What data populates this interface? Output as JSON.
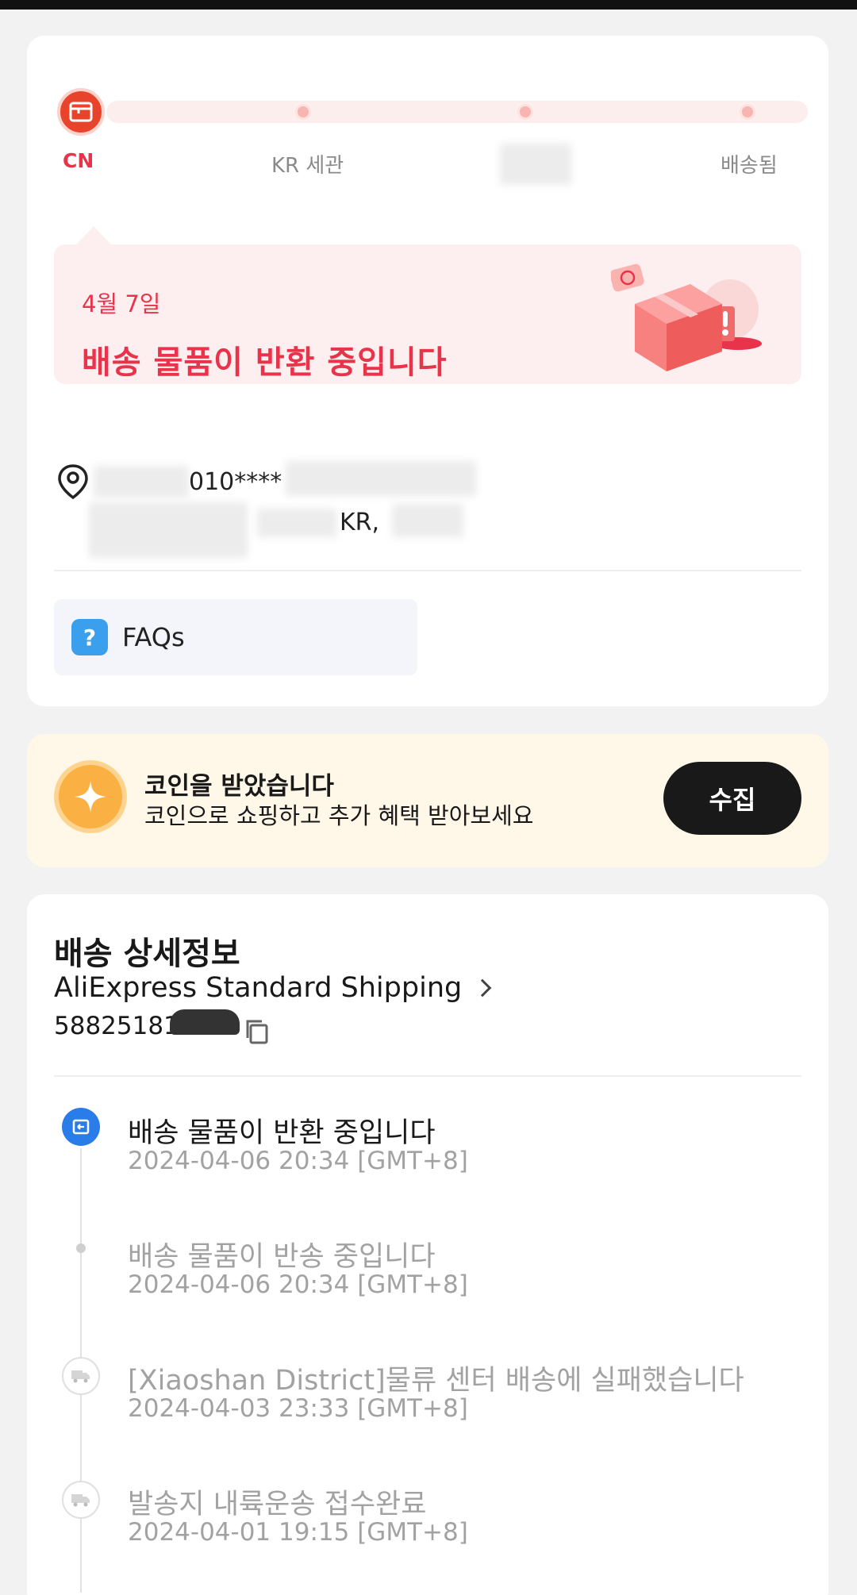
{
  "progress": {
    "steps": [
      "CN",
      "KR 세관",
      "",
      "배송됨"
    ],
    "colors": {
      "active": "#e8334a",
      "track": "#fdeeee"
    }
  },
  "status": {
    "date": "4월 7일",
    "title": "배송 물품이 반환 중입니다"
  },
  "address": {
    "line1": "010****",
    "line2": "KR,"
  },
  "faq": {
    "label": "FAQs"
  },
  "coins": {
    "title": "코인을 받았습니다",
    "subtitle": "코인으로 쇼핑하고 추가 혜택 받아보세요",
    "button": "수집"
  },
  "shipping": {
    "title": "배송 상세정보",
    "carrier": "AliExpress Standard Shipping",
    "tracking_prefix": "58825181",
    "events": [
      {
        "title": "배송 물품이 반환 중입니다",
        "time": "2024-04-06 20:34 [GMT+8]",
        "icon": "return-icon"
      },
      {
        "title": "배송 물품이 반송 중입니다",
        "time": "2024-04-06 20:34 [GMT+8]",
        "icon": "dot"
      },
      {
        "title": "[Xiaoshan District]물류 센터 배송에 실패했습니다",
        "time": "2024-04-03 23:33 [GMT+8]",
        "icon": "truck-icon"
      },
      {
        "title": "발송지 내륙운송 접수완료",
        "time": "2024-04-01 19:15 [GMT+8]",
        "icon": "truck-icon"
      }
    ]
  }
}
